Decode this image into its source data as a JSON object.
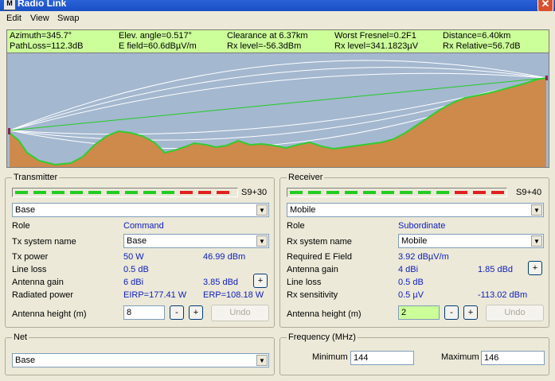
{
  "window": {
    "title": "Radio Link",
    "app_icon": "M",
    "close_glyph": "✕"
  },
  "menu": {
    "items": [
      "Edit",
      "View",
      "Swap"
    ]
  },
  "info": {
    "row1": [
      "Azimuth=345.7°",
      "Elev. angle=0.517°",
      "Clearance at 6.37km",
      "Worst Fresnel=0.2F1",
      "Distance=6.40km"
    ],
    "row2": [
      "PathLoss=112.3dB",
      "E field=60.6dBµV/m",
      "Rx level=-56.3dBm",
      "Rx level=341.1823µV",
      "Rx Relative=56.7dB"
    ]
  },
  "colors": {
    "terrain": "#cd8a4a",
    "terrain_edge": "#33cc33",
    "sky": "#a4b8d0",
    "los_line": "#22cc22",
    "meter_green": "#22cc22",
    "meter_red": "#e02020",
    "info_bg": "#ccff99"
  },
  "transmitter": {
    "title": "Transmitter",
    "meter_label": "S9+30",
    "meter_segments": [
      "green",
      "green",
      "green",
      "green",
      "green",
      "green",
      "green",
      "green",
      "green",
      "red",
      "red",
      "red"
    ],
    "unit": "Base",
    "role_label": "Role",
    "role_value": "Command",
    "system_label": "Tx system name",
    "system_value": "Base",
    "power_label": "Tx power",
    "power_w": "50 W",
    "power_dbm": "46.99 dBm",
    "loss_label": "Line loss",
    "loss_value": "0.5 dB",
    "gain_label": "Antenna gain",
    "gain_dbi": "6 dBi",
    "gain_dbd": "3.85 dBd",
    "plus_label": "+",
    "radiated_label": "Radiated power",
    "eirp": "EIRP=177.41 W",
    "erp": "ERP=108.18 W",
    "height_label": "Antenna height (m)",
    "height_value": "8",
    "minus_label": "-",
    "undo_label": "Undo"
  },
  "receiver": {
    "title": "Receiver",
    "meter_label": "S9+40",
    "meter_segments": [
      "green",
      "green",
      "green",
      "green",
      "green",
      "green",
      "green",
      "green",
      "green",
      "red",
      "red",
      "red"
    ],
    "unit": "Mobile",
    "role_label": "Role",
    "role_value": "Subordinate",
    "system_label": "Rx system name",
    "system_value": "Mobile",
    "efield_label": "Required E Field",
    "efield_value": "3.92 dBµV/m",
    "gain_label": "Antenna gain",
    "gain_dbi": "4 dBi",
    "gain_dbd": "1.85 dBd",
    "plus_label": "+",
    "loss_label": "Line loss",
    "loss_value": "0.5 dB",
    "sens_label": "Rx sensitivity",
    "sens_uv": "0.5 µV",
    "sens_dbm": "-113.02 dBm",
    "height_label": "Antenna height (m)",
    "height_value": "2",
    "minus_label": "-",
    "undo_label": "Undo"
  },
  "net": {
    "title": "Net",
    "value": "Base"
  },
  "frequency": {
    "title": "Frequency (MHz)",
    "min_label": "Minimum",
    "min_value": "144",
    "max_label": "Maximum",
    "max_value": "146"
  }
}
